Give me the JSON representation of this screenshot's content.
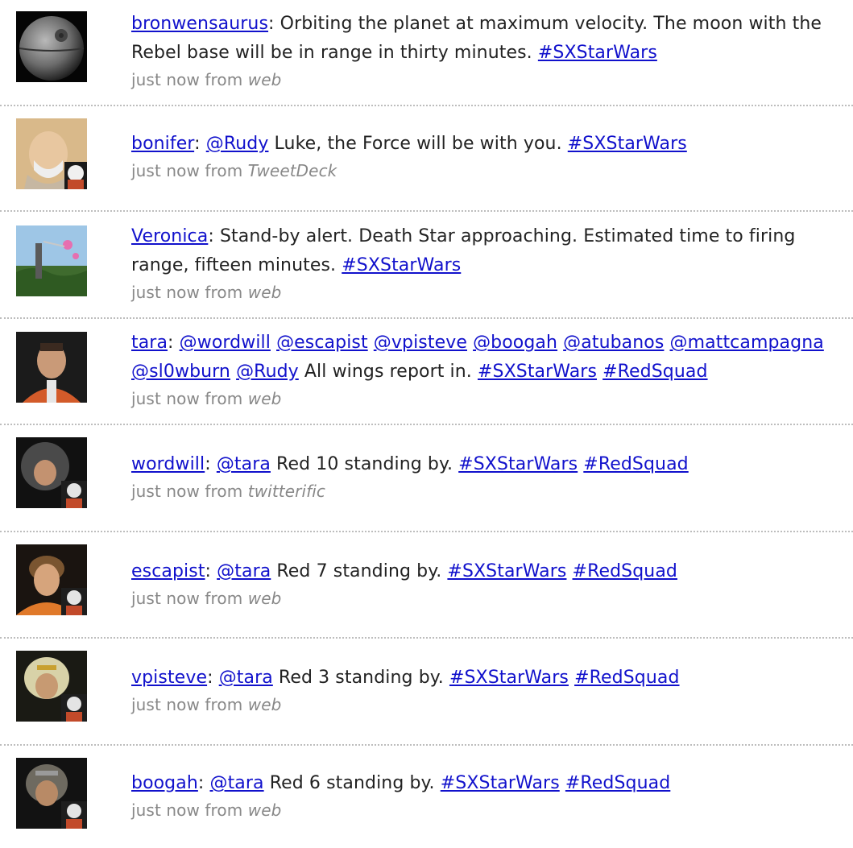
{
  "tweets": [
    {
      "user": "bronwensaurus",
      "parts": [
        {
          "t": "text",
          "v": ": Orbiting the planet at maximum velocity.  The moon with the Rebel base will be in range in thirty minutes. "
        },
        {
          "t": "link",
          "v": "#SXStarWars"
        }
      ],
      "time": "just now from ",
      "source": "web",
      "avatar": "death-star"
    },
    {
      "user": "bonifer",
      "parts": [
        {
          "t": "text",
          "v": ": "
        },
        {
          "t": "link",
          "v": "@Rudy"
        },
        {
          "t": "text",
          "v": " Luke, the Force will be with you. "
        },
        {
          "t": "link",
          "v": "#SXStarWars"
        }
      ],
      "time": "just now from ",
      "source": "TweetDeck",
      "avatar": "obiwan"
    },
    {
      "user": "Veronica",
      "parts": [
        {
          "t": "text",
          "v": ": Stand-by alert.  Death Star approaching.  Estimated time to firing range, fifteen minutes. "
        },
        {
          "t": "link",
          "v": "#SXStarWars"
        }
      ],
      "time": "just now from ",
      "source": "web",
      "avatar": "yavin"
    },
    {
      "user": "tara",
      "parts": [
        {
          "t": "text",
          "v": ": "
        },
        {
          "t": "link",
          "v": "@wordwill"
        },
        {
          "t": "text",
          "v": " "
        },
        {
          "t": "link",
          "v": "@escapist"
        },
        {
          "t": "text",
          "v": " "
        },
        {
          "t": "link",
          "v": "@vpisteve"
        },
        {
          "t": "text",
          "v": " "
        },
        {
          "t": "link",
          "v": "@boogah"
        },
        {
          "t": "text",
          "v": " "
        },
        {
          "t": "link",
          "v": "@atubanos"
        },
        {
          "t": "text",
          "v": " "
        },
        {
          "t": "link",
          "v": "@mattcampagna"
        },
        {
          "t": "text",
          "v": " "
        },
        {
          "t": "link",
          "v": "@sl0wburn"
        },
        {
          "t": "text",
          "v": " "
        },
        {
          "t": "link",
          "v": "@Rudy"
        },
        {
          "t": "text",
          "v": " All wings report in. "
        },
        {
          "t": "link",
          "v": "#SXStarWars"
        },
        {
          "t": "text",
          "v": " "
        },
        {
          "t": "link",
          "v": "#RedSquad"
        }
      ],
      "time": "just now from ",
      "source": "web",
      "avatar": "pilot-leader"
    },
    {
      "user": "wordwill",
      "parts": [
        {
          "t": "text",
          "v": ": "
        },
        {
          "t": "link",
          "v": "@tara"
        },
        {
          "t": "text",
          "v": " Red 10 standing by. "
        },
        {
          "t": "link",
          "v": "#SXStarWars"
        },
        {
          "t": "text",
          "v": " "
        },
        {
          "t": "link",
          "v": "#RedSquad"
        }
      ],
      "time": "just now from ",
      "source": "twitterific",
      "avatar": "pilot-helmet"
    },
    {
      "user": "escapist",
      "parts": [
        {
          "t": "text",
          "v": ": "
        },
        {
          "t": "link",
          "v": "@tara"
        },
        {
          "t": "text",
          "v": " Red 7 standing by. "
        },
        {
          "t": "link",
          "v": "#SXStarWars"
        },
        {
          "t": "text",
          "v": " "
        },
        {
          "t": "link",
          "v": "#RedSquad"
        }
      ],
      "time": "just now from ",
      "source": "web",
      "avatar": "pilot-orange"
    },
    {
      "user": "vpisteve",
      "parts": [
        {
          "t": "text",
          "v": ": "
        },
        {
          "t": "link",
          "v": "@tara"
        },
        {
          "t": "text",
          "v": " Red 3 standing by. "
        },
        {
          "t": "link",
          "v": "#SXStarWars"
        },
        {
          "t": "text",
          "v": " "
        },
        {
          "t": "link",
          "v": "#RedSquad"
        }
      ],
      "time": "just now from ",
      "source": "web",
      "avatar": "pilot-helmet-white"
    },
    {
      "user": "boogah",
      "parts": [
        {
          "t": "text",
          "v": ": "
        },
        {
          "t": "link",
          "v": "@tara"
        },
        {
          "t": "text",
          "v": " Red 6 standing by. "
        },
        {
          "t": "link",
          "v": "#SXStarWars"
        },
        {
          "t": "text",
          "v": " "
        },
        {
          "t": "link",
          "v": "#RedSquad"
        }
      ],
      "time": "just now from ",
      "source": "web",
      "avatar": "pilot-helmet-dark"
    }
  ]
}
